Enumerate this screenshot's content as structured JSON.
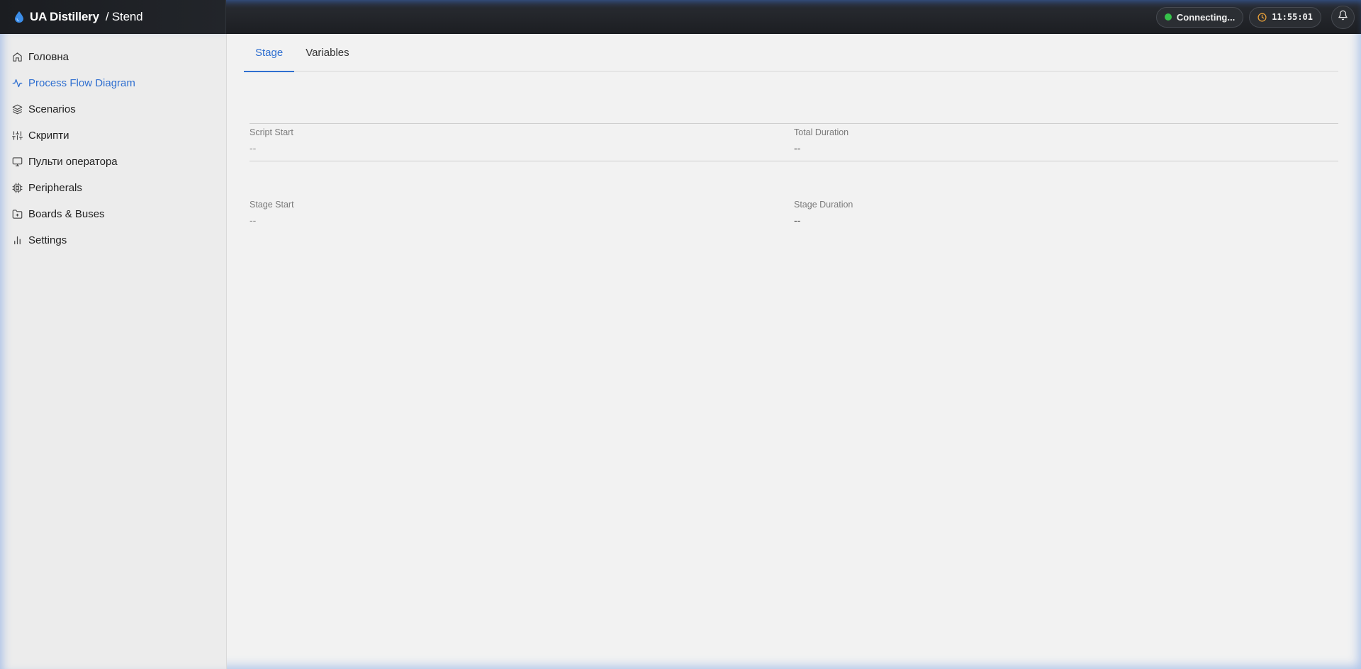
{
  "header": {
    "brand": "UA Distillery",
    "section": "/ Stend",
    "status": "Connecting...",
    "status_color": "#36c24a",
    "clock": "11:55:01"
  },
  "sidebar": {
    "items": [
      {
        "label": "Головна",
        "icon": "home-icon"
      },
      {
        "label": "Process Flow Diagram",
        "icon": "activity-icon",
        "active": true
      },
      {
        "label": "Scenarios",
        "icon": "layers-icon"
      },
      {
        "label": "Скрипти",
        "icon": "sliders-icon"
      },
      {
        "label": "Пульти оператора",
        "icon": "monitor-icon"
      },
      {
        "label": "Peripherals",
        "icon": "cpu-icon"
      },
      {
        "label": "Boards & Buses",
        "icon": "folder-plus-icon"
      },
      {
        "label": "Settings",
        "icon": "bar-chart-icon"
      }
    ]
  },
  "tabs": [
    {
      "label": "Stage",
      "active": true
    },
    {
      "label": "Variables",
      "active": false
    }
  ],
  "script_info": {
    "script_start_label": "Script Start",
    "script_start_value": "--",
    "total_duration_label": "Total Duration",
    "total_duration_value": "--"
  },
  "stage_info": {
    "stage_start_label": "Stage Start",
    "stage_start_value": "--",
    "stage_duration_label": "Stage Duration",
    "stage_duration_value": "--"
  },
  "colors": {
    "accent": "#2f6fd0",
    "topbar": "#1e2024"
  }
}
